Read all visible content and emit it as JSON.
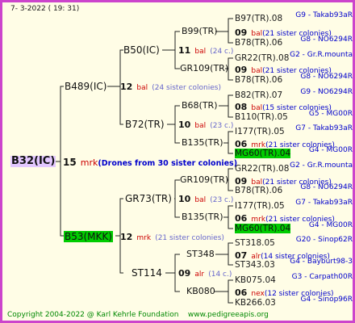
{
  "header": {
    "date": "7-  3-2022 ( 19: 31)"
  },
  "root": {
    "label": "B32(IC)"
  },
  "root_gen": {
    "count": "15",
    "kind": "mrk",
    "note": "(Drones from 30 sister colonies)"
  },
  "sire": {
    "label": "B489(IC)",
    "gen_count": "12",
    "gen_kind": "bal",
    "gen_note": "(24 sister colonies)"
  },
  "dam": {
    "label": "B53(MKK)",
    "gen_count": "12",
    "gen_kind": "mrk",
    "gen_note": "(21 sister colonies)"
  },
  "ss": {
    "label": "B50(IC)",
    "gen_count": "11",
    "gen_kind": "bal",
    "gen_note": "(24 c.)"
  },
  "sd": {
    "label": "B72(TR)",
    "gen_count": "10",
    "gen_kind": "bal",
    "gen_note": "(23 c.)"
  },
  "ds": {
    "label": "GR73(TR)",
    "gen_count": "10",
    "gen_kind": "bal",
    "gen_note": "(23 c.)"
  },
  "dd": {
    "label": "ST114",
    "gen_count": "09",
    "gen_kind": "alr",
    "gen_note": "(14 c.)"
  },
  "g3": {
    "sss": "B99(TR)",
    "ssd": "GR109(TR)",
    "sds": "B68(TR)",
    "sdd": "B135(TR)",
    "dss": "GR109(TR)",
    "dsd": "B135(TR)",
    "dds": "ST348",
    "ddd": "KB080"
  },
  "g3_gen": {
    "ss": {
      "count": "09",
      "kind": "bal",
      "note": "(21 sister colonies)"
    },
    "sd": {
      "count": "10",
      "kind": "bal",
      "note": "(23 c.)"
    },
    "ds": {
      "count": "09",
      "kind": "bal",
      "note": "(21 sister colonies)"
    },
    "dd": {
      "count": "07",
      "kind": "alr",
      "note": "(14 sister colonies)"
    }
  },
  "g4": [
    {
      "id": "B97(TR).08",
      "info": "G9 - Takab93aR"
    },
    {
      "id": "B78(TR).06",
      "info": "G8 - NO6294R"
    },
    {
      "id": "GR22(TR).08",
      "info": "G2 - Gr.R.mounta"
    },
    {
      "id": "B78(TR).06",
      "info": "G8 - NO6294R"
    },
    {
      "id": "B82(TR).07",
      "info": "G9 - NO6294R"
    },
    {
      "id": "B110(TR).05",
      "info": "G5 - MG00R"
    },
    {
      "id": "I177(TR).05",
      "info": "G7 - Takab93aR"
    },
    {
      "id": "MG60(TR).04",
      "info": "G4 - MG00R",
      "highlight": true
    },
    {
      "id": "GR22(TR).08",
      "info": "G2 - Gr.R.mounta"
    },
    {
      "id": "B78(TR).06",
      "info": "G8 - NO6294R"
    },
    {
      "id": "I177(TR).05",
      "info": "G7 - Takab93aR"
    },
    {
      "id": "MG60(TR).04",
      "info": "G4 - MG00R",
      "highlight": true
    },
    {
      "id": "ST318.05",
      "info": "G20 - Sinop62R"
    },
    {
      "id": "ST343.03",
      "info": "G4 - Bayburt98-3"
    },
    {
      "id": "KB075.04",
      "info": "G3 - Carpath00R"
    },
    {
      "id": "KB266.03",
      "info": "G4 - Sinop96R"
    }
  ],
  "g4_gen": [
    {
      "count": "09",
      "kind": "bal",
      "note": "(21 sister colonies)"
    },
    {
      "count": "09",
      "kind": "bal",
      "note": "(21 sister colonies)"
    },
    {
      "count": "08",
      "kind": "bal",
      "note": "(15 sister colonies)"
    },
    {
      "count": "06",
      "kind": "mrk",
      "note": "(21 sister colonies)"
    },
    {
      "count": "09",
      "kind": "bal",
      "note": "(21 sister colonies)"
    },
    {
      "count": "06",
      "kind": "mrk",
      "note": "(21 sister colonies)"
    },
    {
      "count": "07",
      "kind": "alr",
      "note": "(14 sister colonies)"
    },
    {
      "count": "06",
      "kind": "nex",
      "note": "(12 sister colonies)"
    }
  ],
  "footer": {
    "copyright": "Copyright 2004-2022 @ Karl Kehrle Foundation",
    "url": "www.pedigreeapis.org"
  },
  "colors": {
    "frame": "#cc44cc",
    "background": "#fffde6",
    "highlight": "#00cc00",
    "root_bg": "#e3c8ff",
    "line_red": "#cc0000",
    "line_blue": "#0000cc",
    "footer": "#008800"
  }
}
